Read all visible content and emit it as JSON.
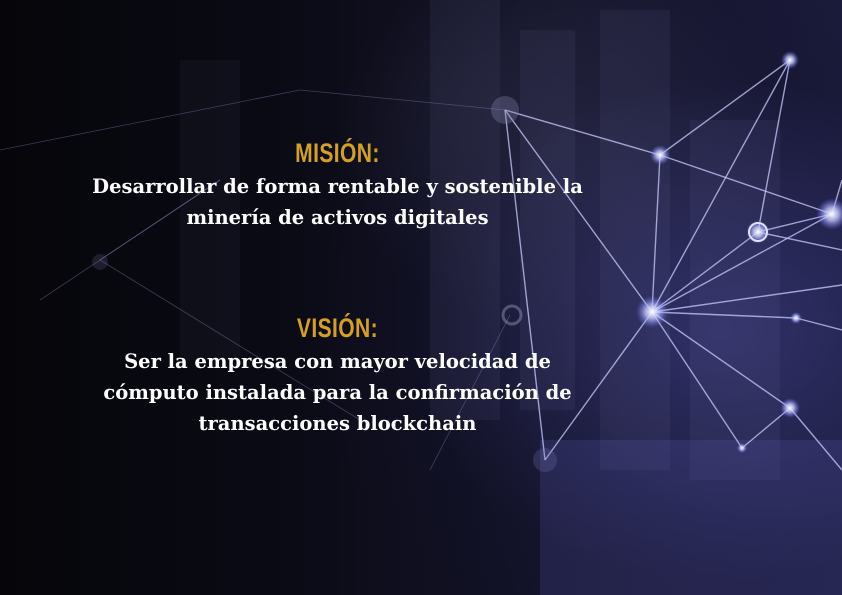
{
  "mission": {
    "heading": "MISIÓN:",
    "lines": [
      "Desarrollar de forma rentable y sostenible la",
      "minería de activos digitales"
    ]
  },
  "vision": {
    "heading": "VISIÓN:",
    "lines": [
      "Ser la empresa con mayor velocidad de",
      "cómputo instalada para la confirmación de",
      "transacciones blockchain"
    ]
  },
  "colors": {
    "heading": "#d4a023",
    "text": "#ffffff",
    "network": "#c8ccff"
  }
}
